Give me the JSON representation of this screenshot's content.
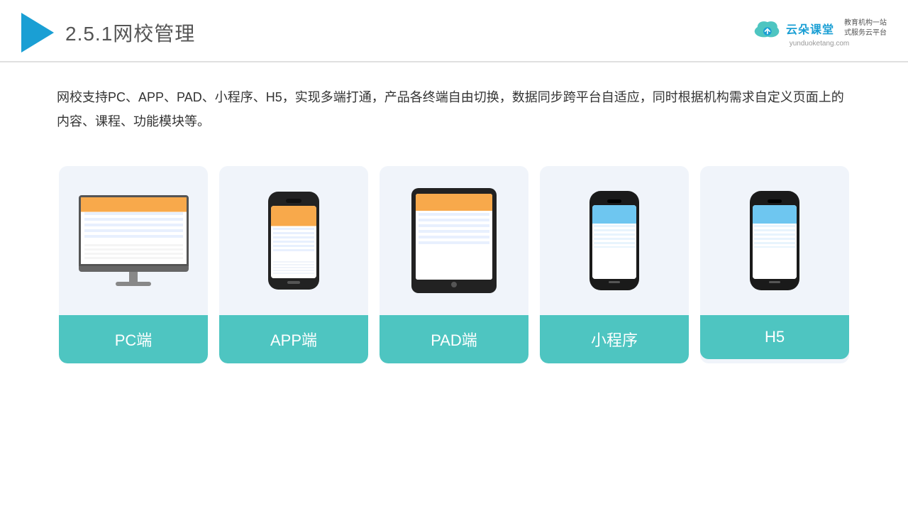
{
  "header": {
    "section_number": "2.5.1",
    "title": "网校管理",
    "brand_name": "云朵课堂",
    "brand_url": "yunduoketang.com",
    "brand_slogan_line1": "教育机构一站",
    "brand_slogan_line2": "式服务云平台"
  },
  "description": {
    "text": "网校支持PC、APP、PAD、小程序、H5，实现多端打通，产品各终端自由切换，数据同步跨平台自适应，同时根据机构需求自定义页面上的内容、课程、功能模块等。"
  },
  "cards": [
    {
      "id": "pc",
      "label": "PC端",
      "type": "pc"
    },
    {
      "id": "app",
      "label": "APP端",
      "type": "phone"
    },
    {
      "id": "pad",
      "label": "PAD端",
      "type": "tablet"
    },
    {
      "id": "miniprogram",
      "label": "小程序",
      "type": "mini-phone"
    },
    {
      "id": "h5",
      "label": "H5",
      "type": "h5-phone"
    }
  ]
}
